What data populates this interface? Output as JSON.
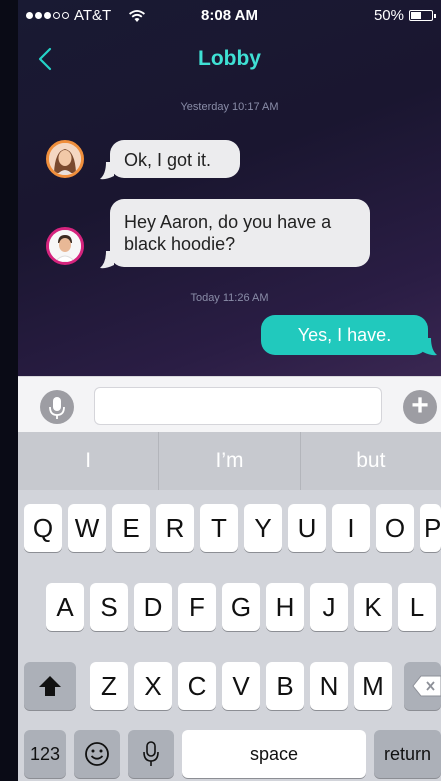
{
  "status_bar": {
    "carrier": "AT&T",
    "time": "8:08 AM",
    "battery": "50%",
    "battery_level": 0.5,
    "signal_bars": 3,
    "signal_max": 5
  },
  "navbar": {
    "back_icon": "chevron-left-icon",
    "title": "Lobby"
  },
  "messages": [
    {
      "type": "timestamp",
      "text": "Yesterday 10:17 AM"
    },
    {
      "type": "incoming",
      "text": "Ok, I got it.",
      "avatar": "woman-avatar"
    },
    {
      "type": "incoming",
      "text": "Hey Aaron, do you have a black hoodie?",
      "avatar": "man-avatar"
    },
    {
      "type": "timestamp",
      "text": "Today 11:26 AM"
    },
    {
      "type": "outgoing",
      "text": "Yes, I have."
    }
  ],
  "composer": {
    "mic_icon": "microphone-icon",
    "value": "",
    "placeholder": "",
    "plus_icon": "plus-icon"
  },
  "suggestions": [
    "I",
    "I’m",
    "but"
  ],
  "keyboard": {
    "row1": [
      "Q",
      "W",
      "E",
      "R",
      "T",
      "Y",
      "U",
      "I",
      "O",
      "P"
    ],
    "row2": [
      "A",
      "S",
      "D",
      "F",
      "G",
      "H",
      "J",
      "K",
      "L"
    ],
    "row3": [
      "Z",
      "X",
      "C",
      "V",
      "B",
      "N",
      "M"
    ],
    "numbers_label": "123",
    "space_label": "space",
    "return_label": "return"
  },
  "colors": {
    "accent": "#21c9bd",
    "title": "#3fe0d4",
    "avatar_ring_1": "#f08f3c",
    "avatar_ring_2": "#d6247e"
  }
}
